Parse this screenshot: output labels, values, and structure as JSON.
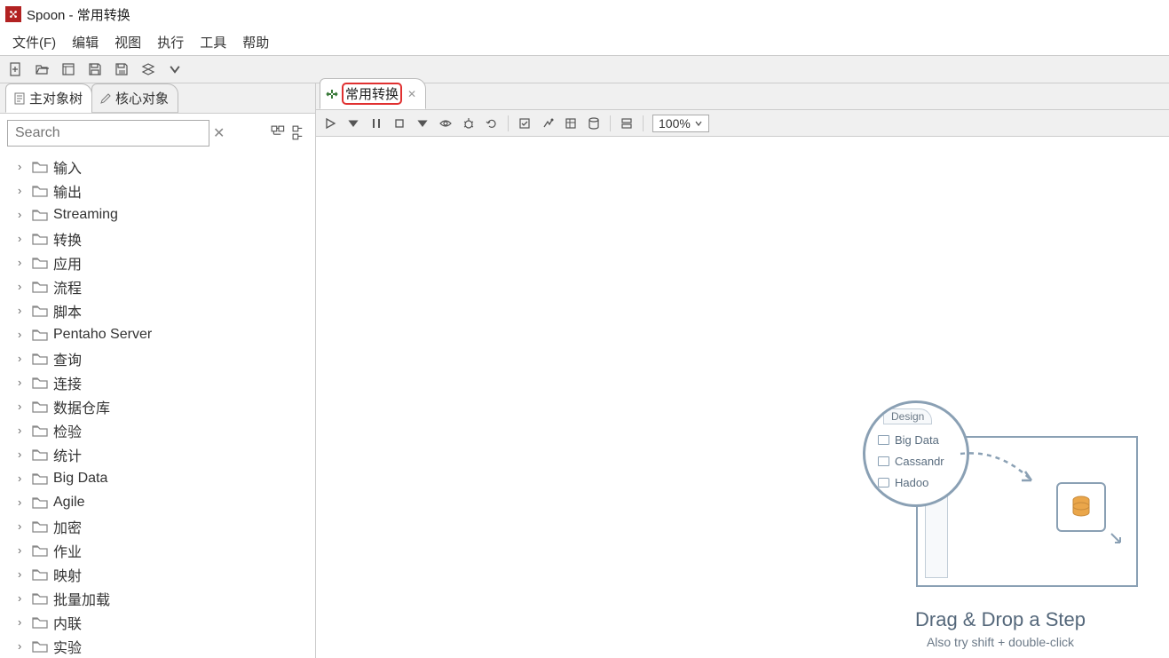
{
  "titlebar": {
    "title": "Spoon - 常用转换"
  },
  "menubar": {
    "items": [
      "文件(F)",
      "编辑",
      "视图",
      "执行",
      "工具",
      "帮助"
    ]
  },
  "sidebar": {
    "tabs": [
      {
        "label": "主对象树",
        "icon": "doc"
      },
      {
        "label": "核心对象",
        "icon": "pencil"
      }
    ],
    "search_placeholder": "Search",
    "tree": [
      "输入",
      "输出",
      "Streaming",
      "转换",
      "应用",
      "流程",
      "脚本",
      "Pentaho Server",
      "查询",
      "连接",
      "数据仓库",
      "检验",
      "统计",
      "Big Data",
      "Agile",
      "加密",
      "作业",
      "映射",
      "批量加载",
      "内联",
      "实验"
    ]
  },
  "canvas": {
    "tab_label": "常用转换",
    "zoom": "100%",
    "hint_title": "Drag & Drop a Step",
    "hint_sub": "Also try shift + double-click",
    "magnifier": {
      "tab": "Design",
      "rows": [
        "Big Data",
        "Cassandr",
        "Hadoo"
      ]
    }
  }
}
